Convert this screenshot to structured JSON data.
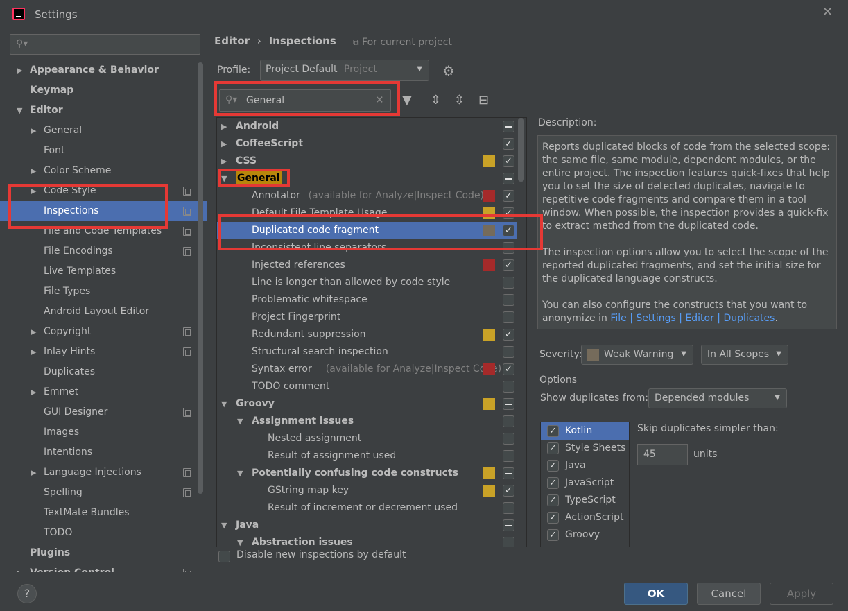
{
  "window": {
    "title": "Settings"
  },
  "left": {
    "search_value": "",
    "items": [
      {
        "label": "Appearance & Behavior",
        "bold": true,
        "arrow": "right",
        "indent": 0
      },
      {
        "label": "Keymap",
        "bold": true,
        "indent": 0
      },
      {
        "label": "Editor",
        "bold": true,
        "arrow": "down",
        "indent": 0
      },
      {
        "label": "General",
        "arrow": "right",
        "indent": 1
      },
      {
        "label": "Font",
        "indent": 1
      },
      {
        "label": "Color Scheme",
        "arrow": "right",
        "indent": 1
      },
      {
        "label": "Code Style",
        "arrow": "right",
        "indent": 1,
        "copy": true
      },
      {
        "label": "Inspections",
        "indent": 1,
        "copy": true,
        "selected": true
      },
      {
        "label": "File and Code Templates",
        "indent": 1,
        "copy": true
      },
      {
        "label": "File Encodings",
        "indent": 1,
        "copy": true
      },
      {
        "label": "Live Templates",
        "indent": 1
      },
      {
        "label": "File Types",
        "indent": 1
      },
      {
        "label": "Android Layout Editor",
        "indent": 1
      },
      {
        "label": "Copyright",
        "arrow": "right",
        "indent": 1,
        "copy": true
      },
      {
        "label": "Inlay Hints",
        "arrow": "right",
        "indent": 1,
        "copy": true
      },
      {
        "label": "Duplicates",
        "indent": 1
      },
      {
        "label": "Emmet",
        "arrow": "right",
        "indent": 1
      },
      {
        "label": "GUI Designer",
        "indent": 1,
        "copy": true
      },
      {
        "label": "Images",
        "indent": 1
      },
      {
        "label": "Intentions",
        "indent": 1
      },
      {
        "label": "Language Injections",
        "arrow": "right",
        "indent": 1,
        "copy": true
      },
      {
        "label": "Spelling",
        "indent": 1,
        "copy": true
      },
      {
        "label": "TextMate Bundles",
        "indent": 1
      },
      {
        "label": "TODO",
        "indent": 1
      },
      {
        "label": "Plugins",
        "bold": true,
        "indent": 0
      },
      {
        "label": "Version Control",
        "bold": true,
        "arrow": "right",
        "indent": 0,
        "copy": true
      }
    ]
  },
  "header": {
    "breadcrumb_editor": "Editor",
    "breadcrumb_sep": "›",
    "breadcrumb_page": "Inspections",
    "for_project": "For current project",
    "profile_label": "Profile:",
    "profile_value": "Project Default",
    "profile_scope": "Project",
    "search_value": "General"
  },
  "colors": {
    "selection": "#4b6eaf",
    "error": "#a52a2a",
    "warning": "#c9a227",
    "weak_warning": "#756b5b",
    "highlight_box": "#e53935"
  },
  "inspections": [
    {
      "label": "Android",
      "bold": true,
      "arrow": "right",
      "level": 0,
      "check": "part"
    },
    {
      "label": "CoffeeScript",
      "bold": true,
      "arrow": "right",
      "level": 0,
      "check": "on"
    },
    {
      "label": "CSS",
      "bold": true,
      "arrow": "right",
      "level": 0,
      "check": "on",
      "sev": "warning"
    },
    {
      "label": "General",
      "bold": true,
      "arrow": "down",
      "level": 0,
      "check": "part",
      "hl": true
    },
    {
      "label": "Annotator",
      "note": "(available for Analyze|Inspect Code)",
      "level": 1,
      "check": "on",
      "sev": "error"
    },
    {
      "label": "Default File Template Usage",
      "level": 1,
      "check": "on",
      "sev": "warning"
    },
    {
      "label": "Duplicated code fragment",
      "level": 1,
      "check": "on",
      "sev": "weak",
      "selected": true
    },
    {
      "label": "Inconsistent line separators",
      "level": 1,
      "check": "off"
    },
    {
      "label": "Injected references",
      "level": 1,
      "check": "on",
      "sev": "error"
    },
    {
      "label": "Line is longer than allowed by code style",
      "level": 1,
      "check": "off"
    },
    {
      "label": "Problematic whitespace",
      "level": 1,
      "check": "off"
    },
    {
      "label": "Project Fingerprint",
      "level": 1,
      "check": "off"
    },
    {
      "label": "Redundant suppression",
      "level": 1,
      "check": "on",
      "sev": "warning"
    },
    {
      "label": "Structural search inspection",
      "level": 1,
      "check": "off"
    },
    {
      "label": "Syntax error",
      "note": "(available for Analyze|Inspect Code)",
      "level": 1,
      "check": "on",
      "sev": "error"
    },
    {
      "label": "TODO comment",
      "level": 1,
      "check": "off"
    },
    {
      "label": "Groovy",
      "bold": true,
      "arrow": "down",
      "level": 0,
      "check": "part",
      "sev": "warning"
    },
    {
      "label": "Assignment issues",
      "bold": true,
      "arrow": "down",
      "level": 1,
      "check": "off"
    },
    {
      "label": "Nested assignment",
      "level": 2,
      "check": "off"
    },
    {
      "label": "Result of assignment used",
      "level": 2,
      "check": "off"
    },
    {
      "label": "Potentially confusing code constructs",
      "bold": true,
      "arrow": "down",
      "level": 1,
      "check": "part",
      "sev": "warning"
    },
    {
      "label": "GString map key",
      "level": 2,
      "check": "on",
      "sev": "warning"
    },
    {
      "label": "Result of increment or decrement used",
      "level": 2,
      "check": "off"
    },
    {
      "label": "Java",
      "bold": true,
      "arrow": "down",
      "level": 0,
      "check": "part"
    },
    {
      "label": "Abstraction issues",
      "bold": true,
      "arrow": "down",
      "level": 1,
      "check": "off"
    }
  ],
  "disable_new_label": "Disable new inspections by default",
  "description": {
    "label": "Description:",
    "p1": "Reports duplicated blocks of code from the selected scope: the same file, same module, dependent modules, or the entire project. The inspection features quick-fixes that help you to set the size of detected duplicates, navigate to repetitive code fragments and compare them in a tool window. When possible, the inspection provides a quick-fix to extract method from the duplicated code.",
    "p2": "The inspection options allow you to select the scope of the reported duplicated fragments, and set the initial size for the duplicated language constructs.",
    "p3_pre": "You can also configure the constructs that you want to anonymize in ",
    "p3_link": "File | Settings | Editor | Duplicates",
    "p3_post": "."
  },
  "severity": {
    "label": "Severity:",
    "value": "Weak Warning",
    "scope": "In All Scopes"
  },
  "options": {
    "label": "Options",
    "show_dup_label": "Show duplicates from:",
    "show_dup_value": "Depended modules",
    "languages": [
      {
        "label": "Kotlin",
        "checked": true,
        "selected": true
      },
      {
        "label": "Style Sheets",
        "checked": true
      },
      {
        "label": "Java",
        "checked": true
      },
      {
        "label": "JavaScript",
        "checked": true
      },
      {
        "label": "TypeScript",
        "checked": true
      },
      {
        "label": "ActionScript",
        "checked": true
      },
      {
        "label": "Groovy",
        "checked": true
      }
    ],
    "skip_label": "Skip duplicates simpler than:",
    "skip_value": "45",
    "units_label": "units"
  },
  "buttons": {
    "help": "?",
    "ok": "OK",
    "cancel": "Cancel",
    "apply": "Apply"
  }
}
